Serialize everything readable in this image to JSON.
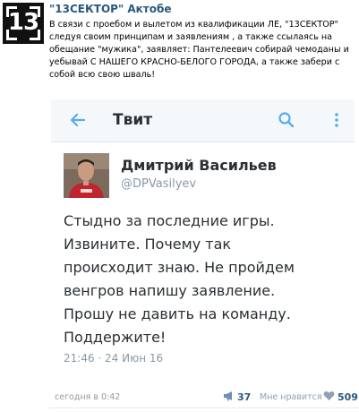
{
  "group": {
    "logo_text": "13",
    "name": "\"13СЕКТОР\" Актобе"
  },
  "post": {
    "text": "В связи с проебом и вылетом из квалификации ЛЕ, \"13СЕКТОР\" следуя своим принципам и заявлениям , а также ссылаясь на обещание \"мужика\", заявляет: Пантелеевич собирай чемоданы и уебывай С НАШЕГО КРАСНО-БЕЛОГО ГОРОДА, а также забери с собой всю свою шваль!",
    "time": "сегодня в 0:42",
    "reposts": "37",
    "likes_label": "Мне нравится",
    "likes": "509"
  },
  "tweet_screen": {
    "title": "Твит",
    "author_name": "Дмитрий Васильев",
    "author_handle": "@DPVasilyev",
    "text": "Стыдно за последние игры.\nИзвините. Почему так\nпроисходит знаю. Не пройдем\nвенгров напишу заявление.\nПрошу не давить на команду.\nПоддержите!",
    "time": "21:46 · 24 Июн 16"
  },
  "icons": {
    "back": "arrow-left-icon",
    "search": "search-icon",
    "more": "more-vertical-icon",
    "repost": "megaphone-icon",
    "like": "heart-icon"
  },
  "colors": {
    "accent": "#55acee",
    "link": "#2b587a",
    "muted": "#8899a6"
  }
}
